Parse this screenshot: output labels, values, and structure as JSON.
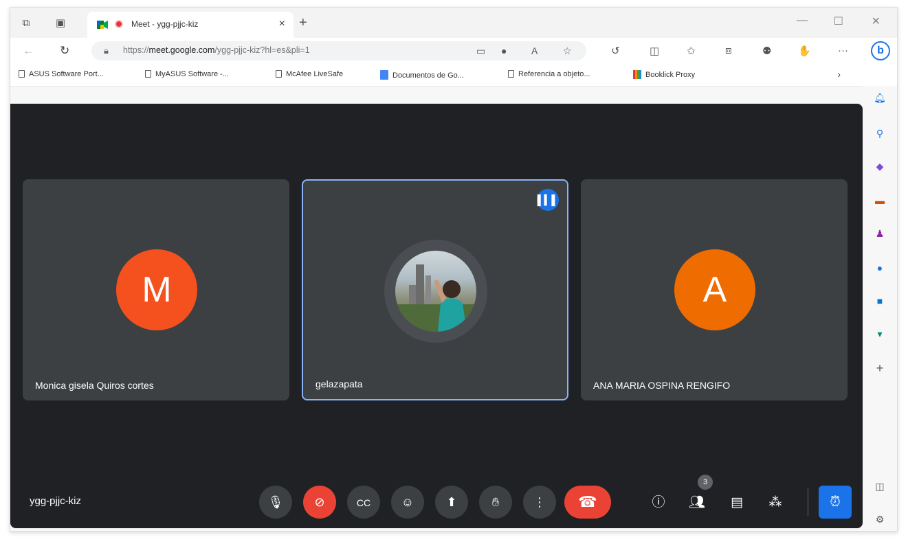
{
  "browser": {
    "tab": {
      "title": "Meet - ygg-pjjc-kiz",
      "favicon": "google-meet-icon",
      "recording_indicator": "recording-dot-icon"
    },
    "url": {
      "prefix": "https://",
      "host": "meet.google.com",
      "path": "/ygg-pjjc-kiz?hl=es&pli=1"
    },
    "bookmarks": [
      {
        "label": "ASUS Software Port...",
        "icon": "page-icon"
      },
      {
        "label": "MyASUS Software -...",
        "icon": "page-icon"
      },
      {
        "label": "McAfee LiveSafe",
        "icon": "page-icon"
      },
      {
        "label": "Documentos de Go...",
        "icon": "docs-icon"
      },
      {
        "label": "Referencia a objeto...",
        "icon": "page-icon"
      },
      {
        "label": "Booklick Proxy",
        "icon": "booklick-icon"
      }
    ]
  },
  "meet": {
    "code": "ygg-pjjc-kiz",
    "participants": [
      {
        "name": "Monica gisela Quiros cortes",
        "initial": "M",
        "color": "#f4511e",
        "active": false
      },
      {
        "name": "gelazapata",
        "initial": "",
        "color": "#4a4e52",
        "active": true
      },
      {
        "name": "ANA MARIA OSPINA RENGIFO",
        "initial": "A",
        "color": "#ef6c00",
        "active": false
      }
    ],
    "participant_count": "3"
  },
  "colors": {
    "meet_bg": "#202124",
    "tile_bg": "#3c4043",
    "accent": "#1a73e8",
    "danger": "#ea4335"
  }
}
